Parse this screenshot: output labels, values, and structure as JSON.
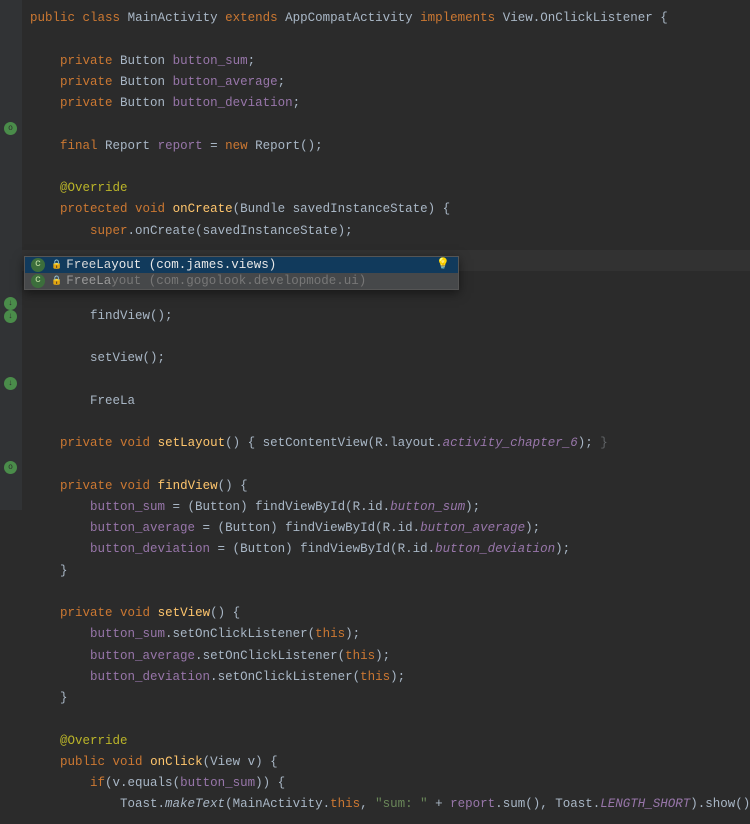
{
  "code": {
    "kw_public": "public",
    "kw_class": "class",
    "cls_MainActivity": "MainActivity",
    "kw_extends": "extends",
    "cls_AppCompat": "AppCompatActivity",
    "kw_implements": "implements",
    "cls_View": "View",
    "cls_OnClick": "OnClickListener",
    "kw_private": "private",
    "cls_Button": "Button",
    "fld_sum": "button_sum",
    "fld_avg": "button_average",
    "fld_dev": "button_deviation",
    "kw_final": "final",
    "cls_Report": "Report",
    "fld_report": "report",
    "kw_new": "new",
    "anno_Override": "@Override",
    "kw_protected": "protected",
    "kw_void": "void",
    "m_onCreate": "onCreate",
    "cls_Bundle": "Bundle",
    "param_sis": "savedInstanceState",
    "kw_super": "super",
    "m_setLayout": "setLayout",
    "m_findView": "findView",
    "m_setView": "setView",
    "typed_FreeLa": "FreeLa",
    "m_setContentView": "setContentView",
    "r_layout": "R.layout.",
    "r_layout_val": "activity_chapter_6",
    "m_findViewById": "findViewById",
    "r_id": "R.id.",
    "r_id_sum": "button_sum",
    "r_id_avg": "button_average",
    "r_id_dev": "button_deviation",
    "m_setOCL": "setOnClickListener",
    "kw_this": "this",
    "m_onClick": "onClick",
    "param_v": "v",
    "kw_if": "if",
    "m_equals": "equals",
    "cls_Toast": "Toast",
    "m_makeText": "makeText",
    "str_sum": "\"sum: \"",
    "m_sum": "sum",
    "c_LENGTH_SHORT": "LENGTH_SHORT",
    "m_show": "show"
  },
  "completion": {
    "items": [
      {
        "match": "FreeLa",
        "rest": "yout",
        "pkg": " (com.james.views)",
        "selected": true
      },
      {
        "match": "FreeLa",
        "rest": "yout",
        "pkg": " (com.gogolook.developmode.ui)",
        "selected": false
      }
    ]
  }
}
